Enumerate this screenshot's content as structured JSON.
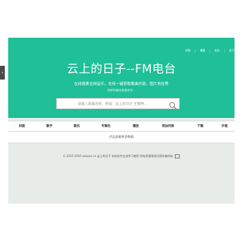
{
  "app": {
    "title": "云上的日子--FM电台",
    "subtitle_line1": "在线搜索全网音乐，支持一键获取歌曲外链，图片地址等",
    "subtitle_line2": "共跨你能往收涨如字..."
  },
  "nav": {
    "items": [
      "导助",
      "博客",
      "电台",
      "关于"
    ],
    "separators": [
      "|",
      "|",
      "|"
    ]
  },
  "search": {
    "placeholder": "请输入歌曲名称，例如：云上的日子 王啸坤..."
  },
  "table": {
    "headers": [
      "封面",
      "歌手",
      "歌名",
      "专辑名",
      "播放",
      "添加列表",
      "下载",
      "外链"
    ],
    "empty_message": "点击加载更多数据"
  },
  "footer": {
    "text": "© 2015-2016 zakuan.cn 云上的日子 本站仅作交流学习使用 所有资源版权归原作者所有"
  },
  "colors": {
    "hero": "#1fbf97",
    "background": "#e7ece9"
  },
  "icons": {
    "search": "magnifier",
    "side_toggle": "chevron-right",
    "footer_image": "image-icon"
  }
}
